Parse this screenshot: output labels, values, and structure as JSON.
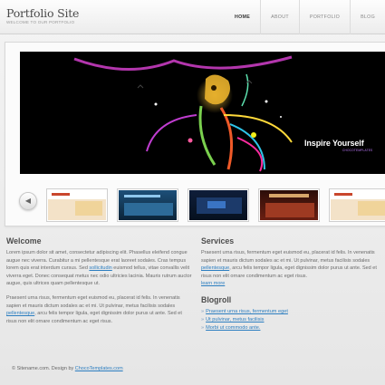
{
  "site": {
    "title": "Portfolio Site",
    "subtitle": "WELCOME TO OUR PORTFOLIO"
  },
  "nav": {
    "items": [
      {
        "label": "HOME",
        "active": true
      },
      {
        "label": "ABOUT",
        "active": false
      },
      {
        "label": "PORTFOLIO",
        "active": false
      },
      {
        "label": "BLOG",
        "active": false
      }
    ]
  },
  "hero": {
    "caption": "Inspire Yourself",
    "caption_sub": "CHOCOTEMPLATES"
  },
  "slider": {
    "prev_icon": "arrow-left-icon",
    "thumbnails": [
      "thumbnail-1",
      "thumbnail-2",
      "thumbnail-3",
      "thumbnail-4",
      "thumbnail-5"
    ]
  },
  "welcome": {
    "heading": "Welcome",
    "p1_before": "Lorem ipsum dolor sit amet, consectetur adipiscing elit. Phasellus eleifend congue augue nec viverra. Curabitur a mi pellentesque erat laoreet sodales. Cras tempus lorem quis erat interdum cursus. Sed ",
    "p1_link": "sollicitudin",
    "p1_after": " euismod tellus, vitae convallis velit viverra eget. Donec consequat metus nec odio ultricies lacinia. Mauris rutrum auctor augue, quis ultrices quam pellentesque ut.",
    "p2_before": "Praesent urna risus, fermentum eget euismod eu, placerat id felis. In venenatis sapien et mauris dictum sodales ac et mi. Ut pulvinar, metus facilisis sodales ",
    "p2_link": "pellentesque",
    "p2_after": ", arcu felis tempor ligula, eget dignissim dolor purus ut ante. Sed et risus non elit ornare condimentum ac eget risus."
  },
  "services": {
    "heading": "Services",
    "p_before": "Praesent urna risus, fermentum eget euismod eu, placerat id felis. In venenatis sapien et mauris dictum sodales ac et mi. Ut pulvinar, metus facilisis sodales ",
    "p_link": "pellentesque",
    "p_after": ", arcu felis tempor ligula, eget dignissim dolor purus ut ante. Sed et risus non elit ornare condimentum ac eget risus.",
    "learn_more": "learn more"
  },
  "blogroll": {
    "heading": "Blogroll",
    "items": [
      "Praesent urna risus, fermentum eget",
      "Ut pulvinar, metus facilisis",
      "Morbi ut commodo ante."
    ]
  },
  "footer": {
    "text": "© Sitename.com. Design by ",
    "link": "ChocoTemplates.com"
  },
  "colors": {
    "link": "#2c7ec0",
    "hero_accent": "#d61fd0",
    "caption_sub": "#c07bff"
  }
}
